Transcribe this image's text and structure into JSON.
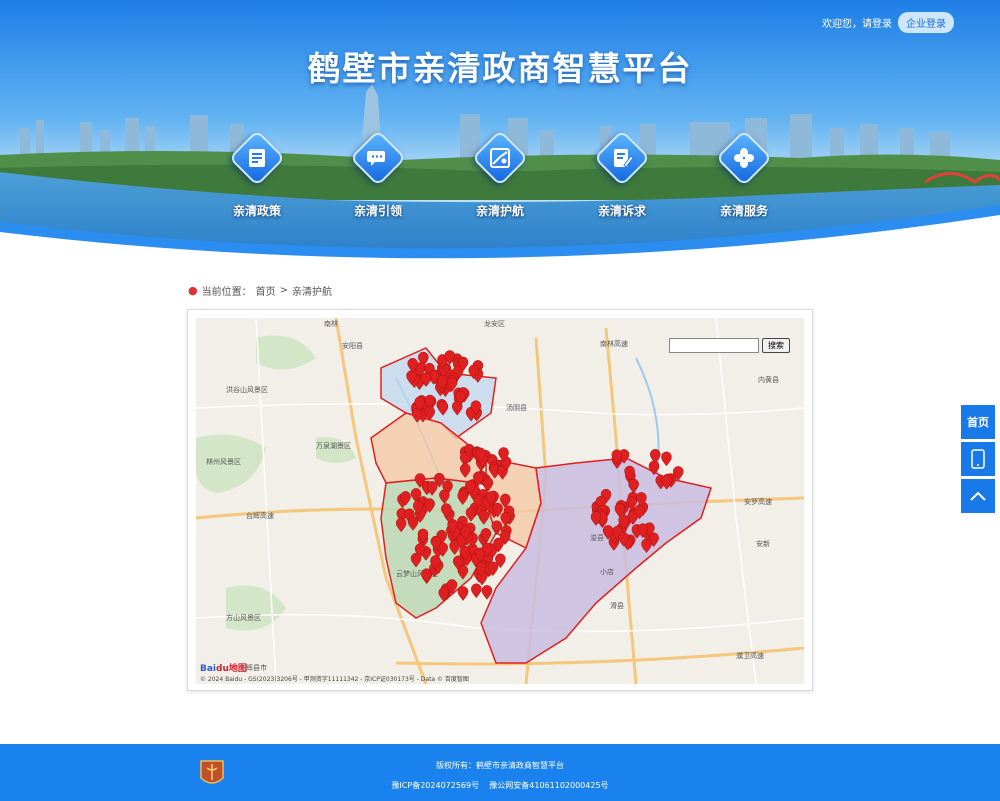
{
  "header": {
    "title": "鹤壁市亲清政商智慧平台",
    "welcome": "欢迎您，请登录",
    "login_button": "企业登录"
  },
  "nav": [
    {
      "label": "亲清政策",
      "icon": "policy-document-icon"
    },
    {
      "label": "亲清引领",
      "icon": "chat-bubbles-icon"
    },
    {
      "label": "亲清护航",
      "icon": "map-route-icon"
    },
    {
      "label": "亲清诉求",
      "icon": "edit-form-icon"
    },
    {
      "label": "亲清服务",
      "icon": "clover-grid-icon"
    }
  ],
  "breadcrumb": {
    "prefix": "当前位置：",
    "home": "首页",
    "separator": " > ",
    "current": "亲清护航"
  },
  "map": {
    "search_placeholder": "",
    "search_button": "搜索",
    "logo_text": "Bai",
    "logo_text_2": "du地图",
    "copyright": "© 2024 Baidu - GS(2023)3206号 - 甲测资字11111342 - 京ICP证030173号 - Data © 百度智图",
    "place_labels": {
      "nanlin": "南林",
      "longan": "龙安区",
      "anyang": "安阳县",
      "tangyin": "汤阴县",
      "neihuang": "内黄县",
      "linzhou_scenic": "林州风景区",
      "hongu_scenic": "洪谷山风景区",
      "wanxian": "万泉湖景区",
      "qixian": "淇县",
      "junxian": "浚县",
      "huaxian": "滑县",
      "hebi": "鹤壁市",
      "huixian": "辉县市",
      "fangshan": "方山风景区",
      "tainan_highway": "台辉高速",
      "nanlin_highway": "南林高速",
      "anlu_highway": "安罗高速",
      "puwei_highway": "濮卫高速",
      "anxin": "安新",
      "xiaodian": "小店",
      "yunmeng": "云梦山风景区"
    }
  },
  "side_tools": {
    "home": "首页"
  },
  "footer": {
    "copyright": "版权所有：鹤壁市亲清政商智慧平台",
    "icp": "豫ICP备2024072569号",
    "police": "豫公网安备41061102000425号"
  },
  "colors": {
    "primary": "#1a82ee",
    "pin": "#e02020",
    "region_border": "#e02020"
  }
}
